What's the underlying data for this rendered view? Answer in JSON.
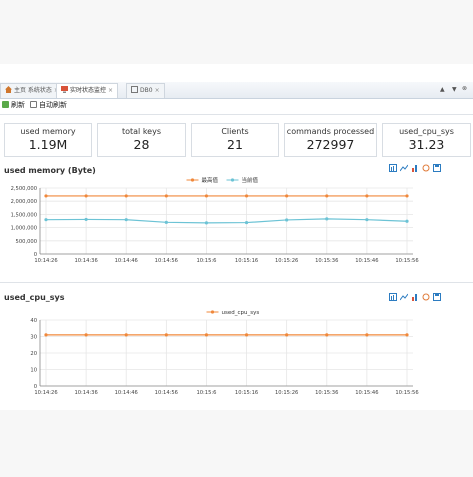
{
  "tabs": [
    {
      "label": "主页 系统状态",
      "closable": true
    },
    {
      "label": "实时状态监控",
      "closable": true
    },
    {
      "label": "DB0",
      "closable": true
    }
  ],
  "window_controls": [
    "▲",
    "▼",
    "⊗"
  ],
  "toolbar": {
    "refresh_label": "刷新",
    "auto_refresh_label": "自动刷新"
  },
  "stats": [
    {
      "label": "used memory",
      "value": "1.19M"
    },
    {
      "label": "total keys",
      "value": "28"
    },
    {
      "label": "Clients",
      "value": "21"
    },
    {
      "label": "commands processed",
      "value": "272997"
    },
    {
      "label": "used_cpu_sys",
      "value": "31.23"
    }
  ],
  "colors": {
    "peak": "#f0883b",
    "current": "#6cc3d5",
    "accent": "#2c7cc1"
  },
  "chart_tools_icons": [
    "bar-chart-icon",
    "line-chart-icon",
    "stack-icon",
    "refresh-icon",
    "save-icon"
  ],
  "chart_data": [
    {
      "type": "line",
      "title": "used memory (Byte)",
      "x": [
        "10:14:26",
        "10:14:36",
        "10:14:46",
        "10:14:56",
        "10:15:6",
        "10:15:16",
        "10:15:26",
        "10:15:36",
        "10:15:46",
        "10:15:56"
      ],
      "series": [
        {
          "name": "最高值",
          "values": [
            2200000,
            2200000,
            2200000,
            2200000,
            2200000,
            2200000,
            2200000,
            2200000,
            2200000,
            2200000
          ]
        },
        {
          "name": "当前值",
          "values": [
            1300000,
            1310000,
            1300000,
            1200000,
            1180000,
            1190000,
            1290000,
            1330000,
            1300000,
            1240000
          ]
        }
      ],
      "ylim": [
        0,
        2500000
      ],
      "yticks": [
        "0",
        "500,000",
        "1,000,000",
        "1,500,000",
        "2,000,000",
        "2,500,000"
      ],
      "grid": true,
      "legend": "top"
    },
    {
      "type": "line",
      "title": "used_cpu_sys",
      "x": [
        "10:14:26",
        "10:14:36",
        "10:14:46",
        "10:14:56",
        "10:15:6",
        "10:15:16",
        "10:15:26",
        "10:15:36",
        "10:15:46",
        "10:15:56"
      ],
      "series": [
        {
          "name": "used_cpu_sys",
          "values": [
            31,
            31,
            31,
            31,
            31,
            31,
            31,
            31,
            31,
            31
          ]
        }
      ],
      "ylim": [
        0,
        40
      ],
      "yticks": [
        "0",
        "10",
        "20",
        "30",
        "40"
      ],
      "grid": true,
      "legend": "top"
    }
  ]
}
